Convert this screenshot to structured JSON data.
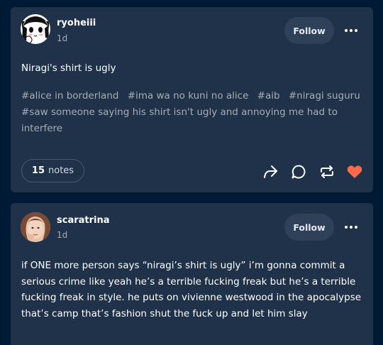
{
  "posts": [
    {
      "username": "ryoheiii",
      "time": "1d",
      "follow_label": "Follow",
      "text": "Niragi's shirt is ugly",
      "tags": [
        "#alice in borderland",
        "#ima wa no kuni no alice",
        "#aib",
        "#niragi suguru",
        "#saw someone saying his shirt isn't ugly and annoying me had to interfere"
      ],
      "notes_count": "15",
      "notes_label": "notes",
      "liked": true
    },
    {
      "username": "scaratrina",
      "time": "1d",
      "follow_label": "Follow",
      "text_lines": [
        "if ONE more person says “niragi’s shirt is ugly” i’m gonna commit a",
        "serious crime like yeah he’s a terrible fucking freak but he’s a terrible",
        "fucking freak in style. he puts on vivienne westwood in the apocalypse",
        "that’s camp that’s fashion shut the fuck up and let him slay"
      ]
    }
  ],
  "colors": {
    "background": "#001935",
    "card": "#1f3249",
    "muted_text": "#a6adb7",
    "like": "#ff6b4a"
  },
  "icons": [
    "more-icon",
    "share-icon",
    "reply-icon",
    "reblog-icon",
    "like-icon"
  ]
}
